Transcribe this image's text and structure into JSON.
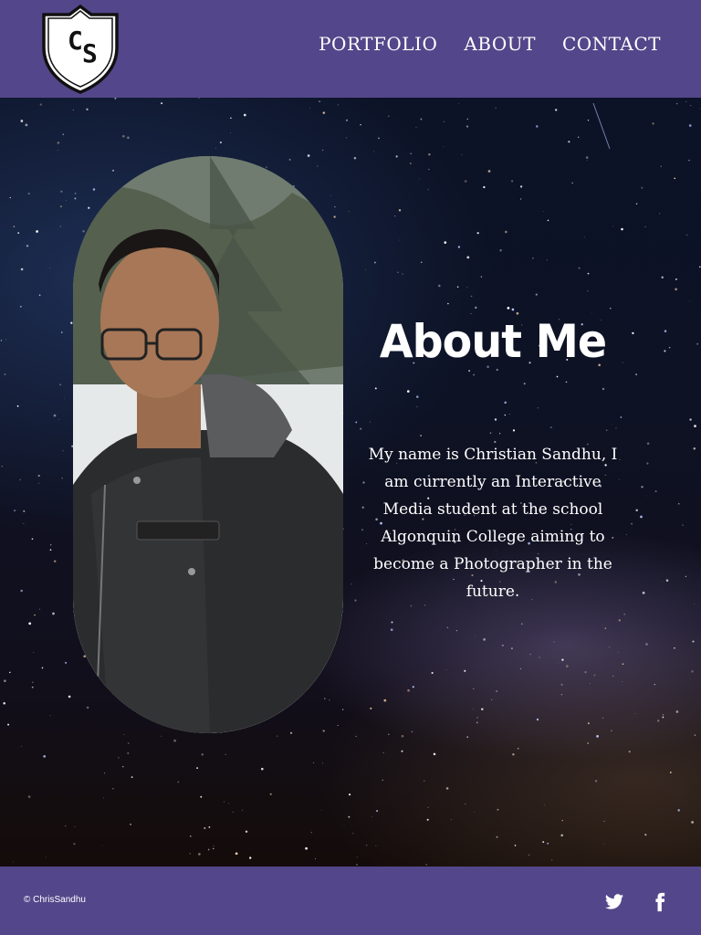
{
  "header": {
    "logo_icon": "cs-shield-logo",
    "logo_text": "CS",
    "nav": [
      {
        "label": "PORTFOLIO"
      },
      {
        "label": "ABOUT"
      },
      {
        "label": "CONTACT"
      }
    ]
  },
  "main": {
    "title": "About Me",
    "body": "My name is Christian Sandhu, I am currently an Interactive Media student at the school Algonquin College aiming to become a Photographer in the future."
  },
  "footer": {
    "copyright": "© ChrisSandhu",
    "social": [
      {
        "icon": "twitter-icon"
      },
      {
        "icon": "facebook-icon"
      }
    ]
  },
  "colors": {
    "brand_purple": "#54468a",
    "text": "#ffffff"
  }
}
